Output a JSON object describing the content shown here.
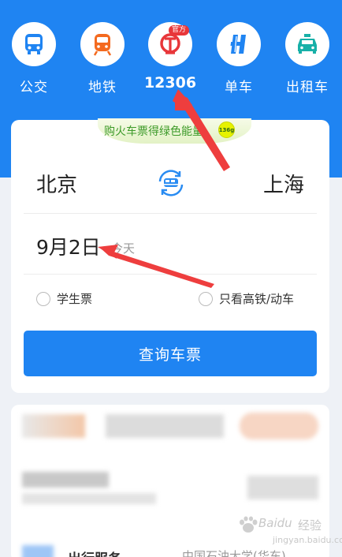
{
  "nav": {
    "items": [
      {
        "label": "公交",
        "icon": "bus-icon"
      },
      {
        "label": "地铁",
        "icon": "subway-icon"
      },
      {
        "label": "12306",
        "icon": "railway-12306-icon",
        "badge": "官方"
      },
      {
        "label": "单车",
        "icon": "bike-icon"
      },
      {
        "label": "出租车",
        "icon": "taxi-icon"
      }
    ]
  },
  "promo": {
    "text": "购火车票得绿色能量",
    "badge": "136g"
  },
  "search": {
    "from": "北京",
    "to": "上海",
    "date": "9月2日",
    "date_hint": "今天",
    "option_student": "学生票",
    "option_high_speed": "只看高铁/动车",
    "query_button": "查询车票"
  },
  "card2": {
    "title_partial": "出行服务",
    "right_partial": "中国石油大学(华东)"
  },
  "watermark": {
    "brand": "Baidu",
    "cn": "经验",
    "url": "jingyan.baidu.com"
  },
  "colors": {
    "primary": "#1f84f2",
    "accent_red": "#e8373a",
    "promo_green": "#3c9a28"
  }
}
